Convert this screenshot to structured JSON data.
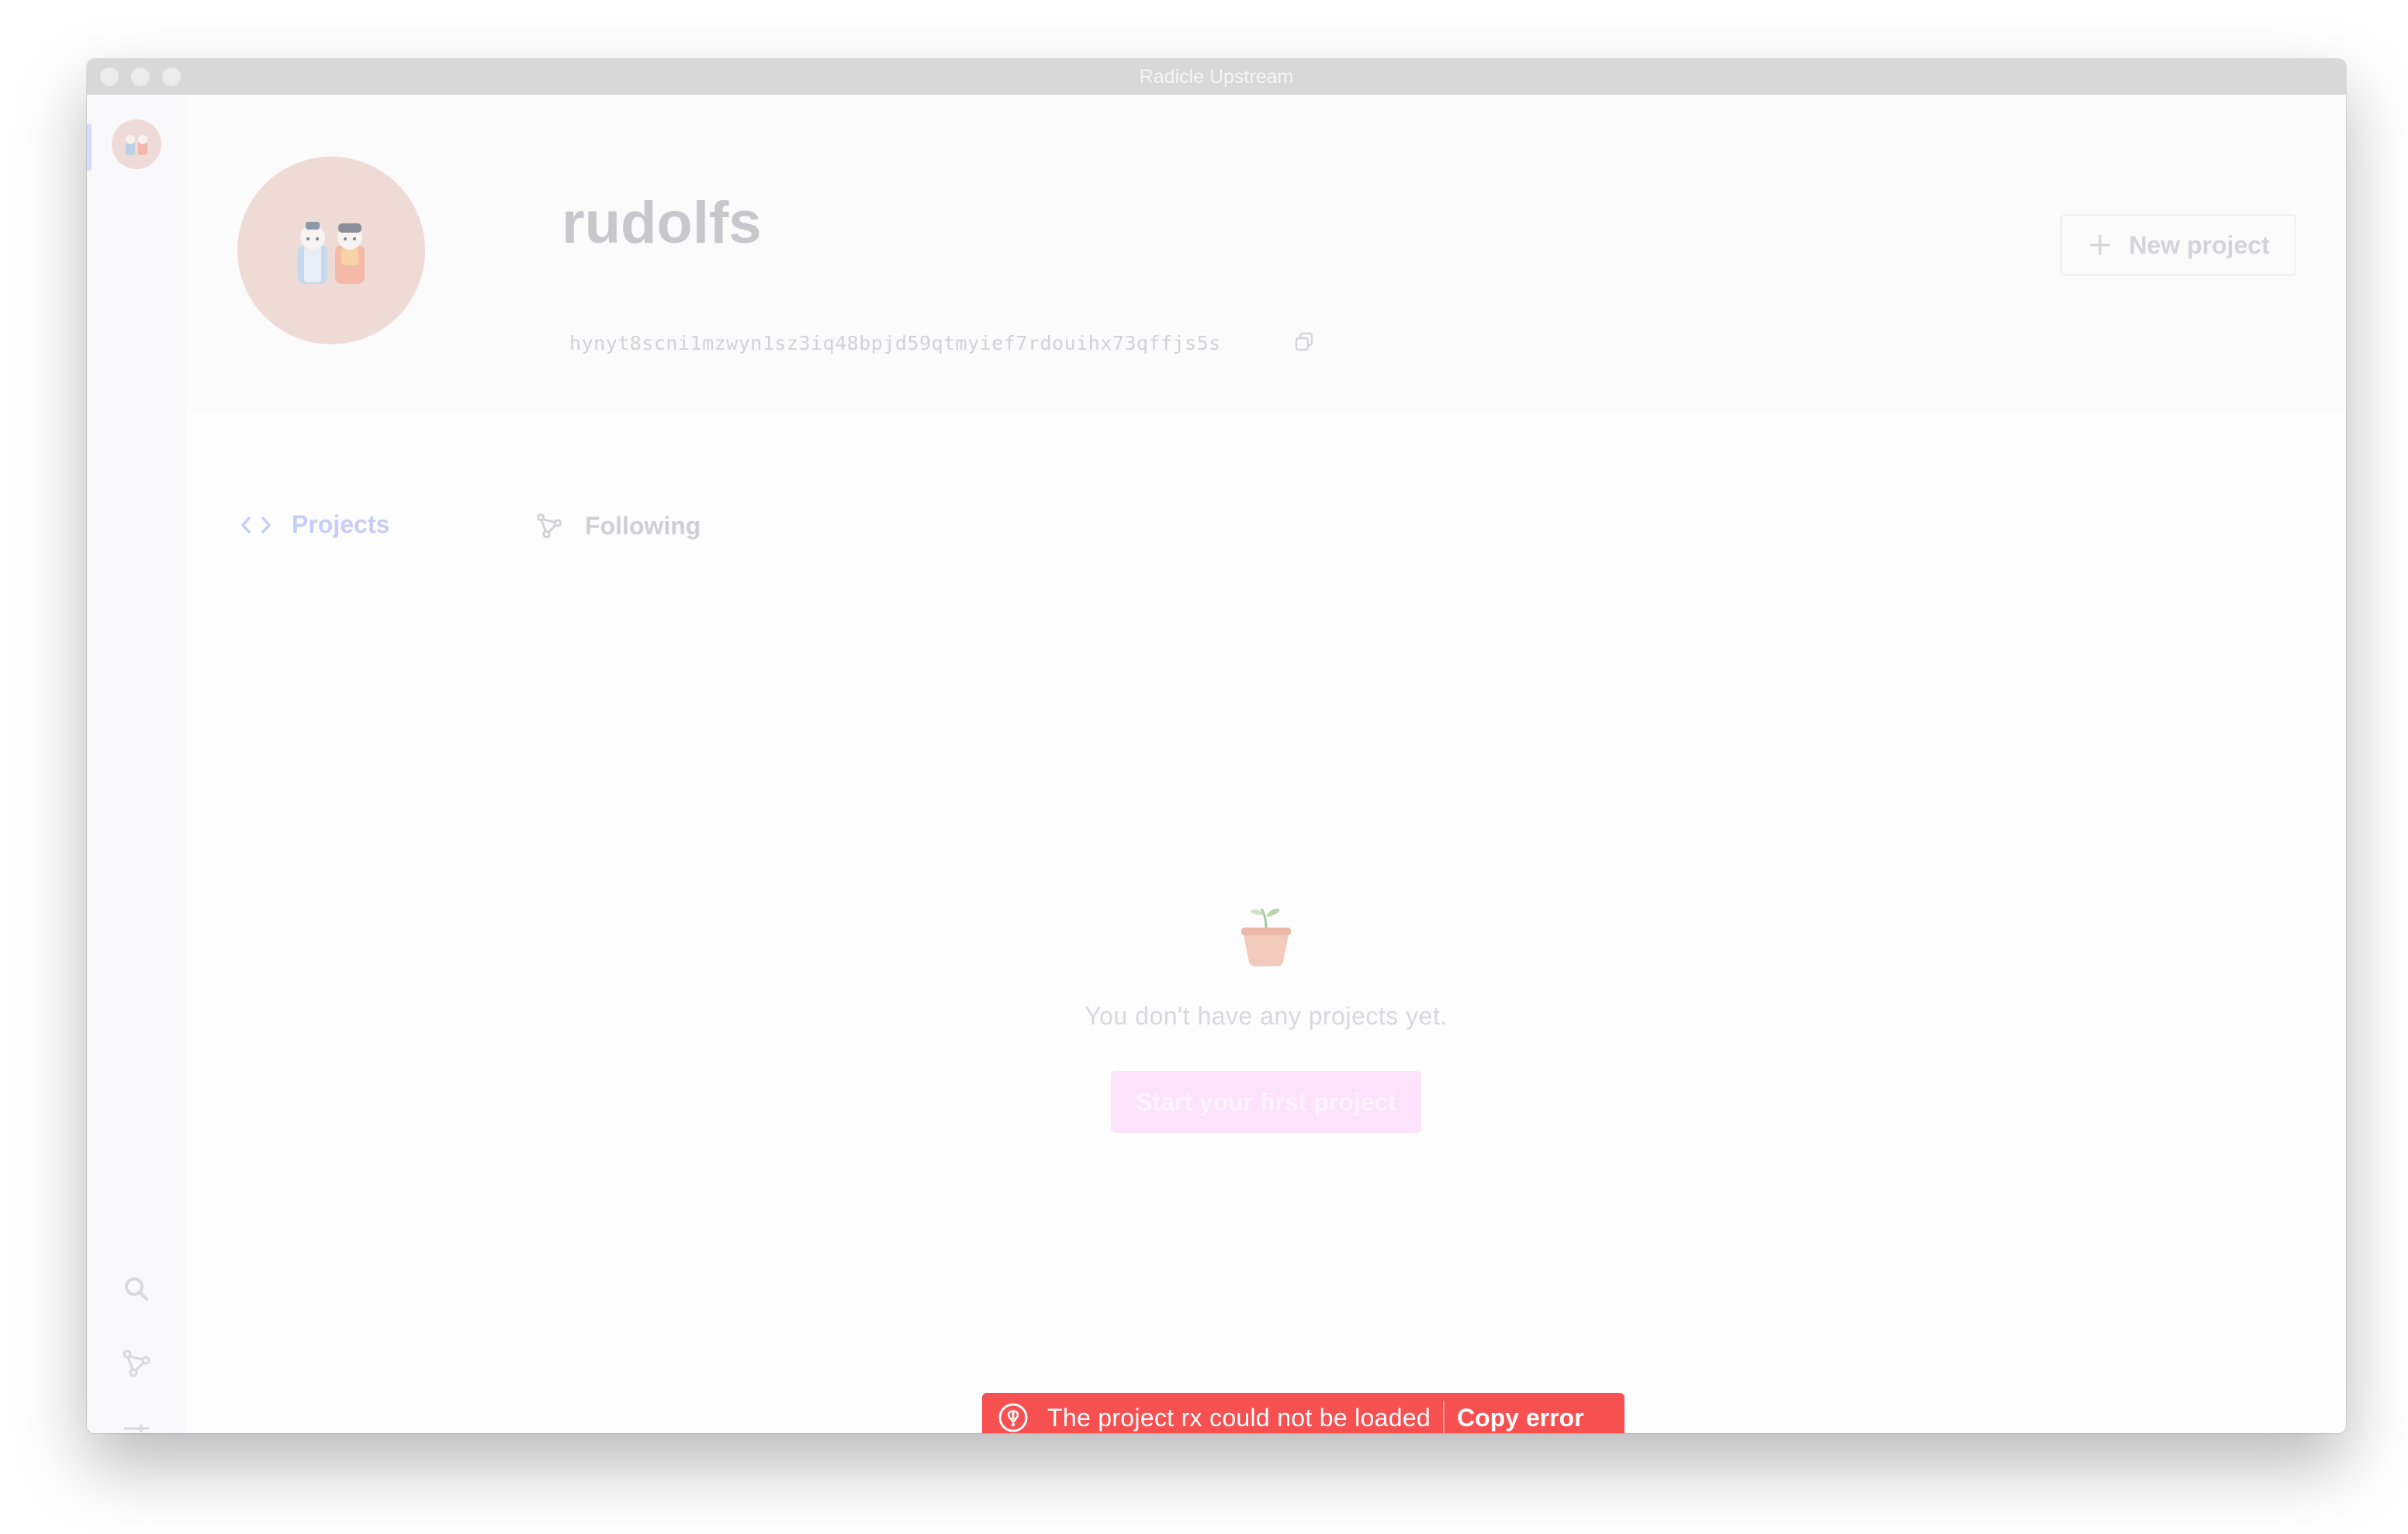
{
  "window": {
    "title": "Radicle Upstream"
  },
  "profile": {
    "name": "rudolfs",
    "peer_id": "hynyt8scni1mzwyn1sz3iq48bpjd59qtmyief7rdouihx73qffjs5s"
  },
  "header": {
    "new_project_label": "New project"
  },
  "tabs": [
    {
      "label": "Projects",
      "icon": "code-brackets-icon",
      "active": true
    },
    {
      "label": "Following",
      "icon": "network-icon",
      "active": false
    }
  ],
  "empty_state": {
    "icon": "plant-pot-icon",
    "message": "You don't have any projects yet.",
    "cta_label": "Start your first project"
  },
  "sidebar": {
    "icons": [
      "search-icon",
      "network-icon",
      "settings-sliders-icon"
    ]
  },
  "toast": {
    "message": "The project rx could not be loaded",
    "action_label": "Copy error",
    "color": "#f65051"
  },
  "colors": {
    "accent": "#c6cdf8",
    "cta": "#fde2fb",
    "error": "#f65051"
  }
}
